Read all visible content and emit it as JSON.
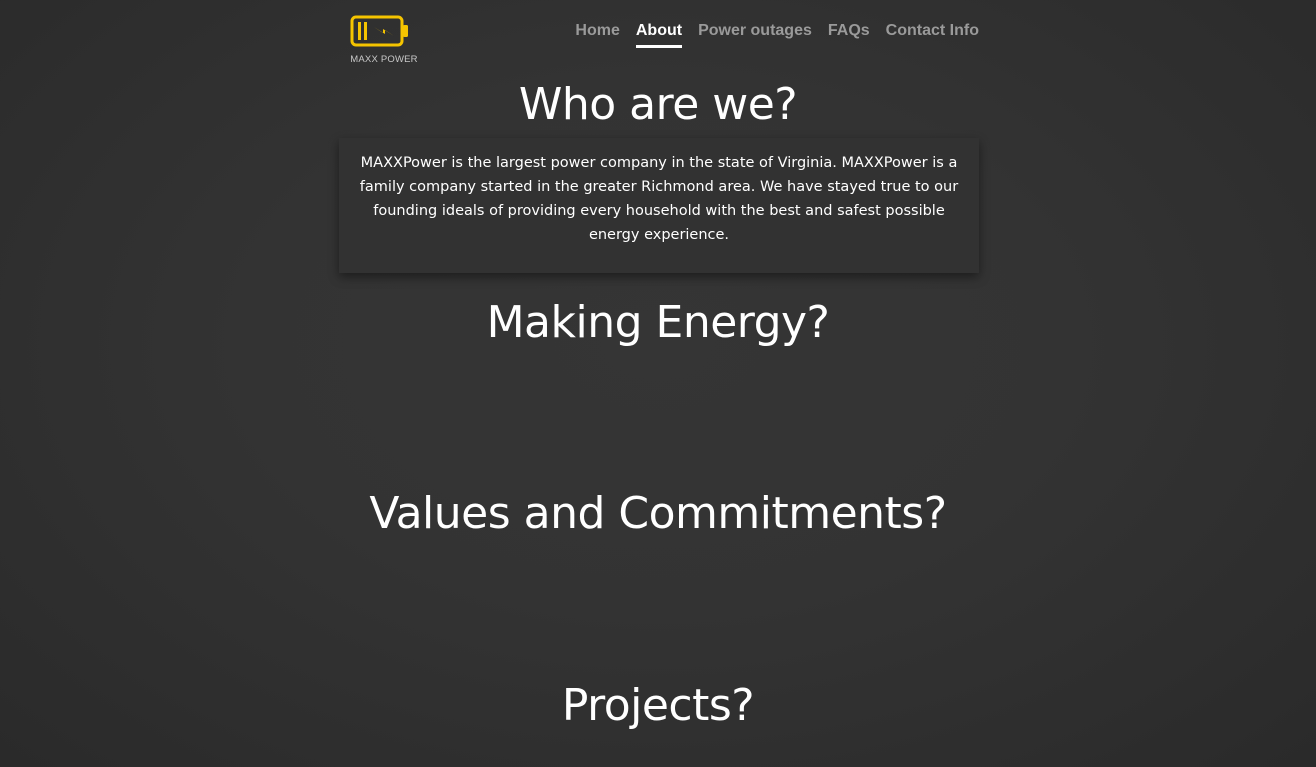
{
  "brand": {
    "name": "MAXX POWER",
    "logo_color": "#f5c400"
  },
  "nav": {
    "items": [
      {
        "label": "Home"
      },
      {
        "label": "About"
      },
      {
        "label": "Power outages"
      },
      {
        "label": "FAQs"
      },
      {
        "label": "Contact Info"
      }
    ],
    "active": "About"
  },
  "sections": {
    "who_title": "Who are we?",
    "who_text": "MAXXPower is the largest power company in the state of Virginia. MAXXPower is a family company started in the greater Richmond area. We have stayed true to our founding ideals of providing every household with the best and safest possible energy experience.",
    "making_title": "Making Energy?",
    "values_title": "Values and Commitments?",
    "projects_title": "Projects?"
  },
  "colors": {
    "background": "#2f2f2f",
    "nav_inactive": "#9a9a9a",
    "nav_active": "#ffffff"
  }
}
